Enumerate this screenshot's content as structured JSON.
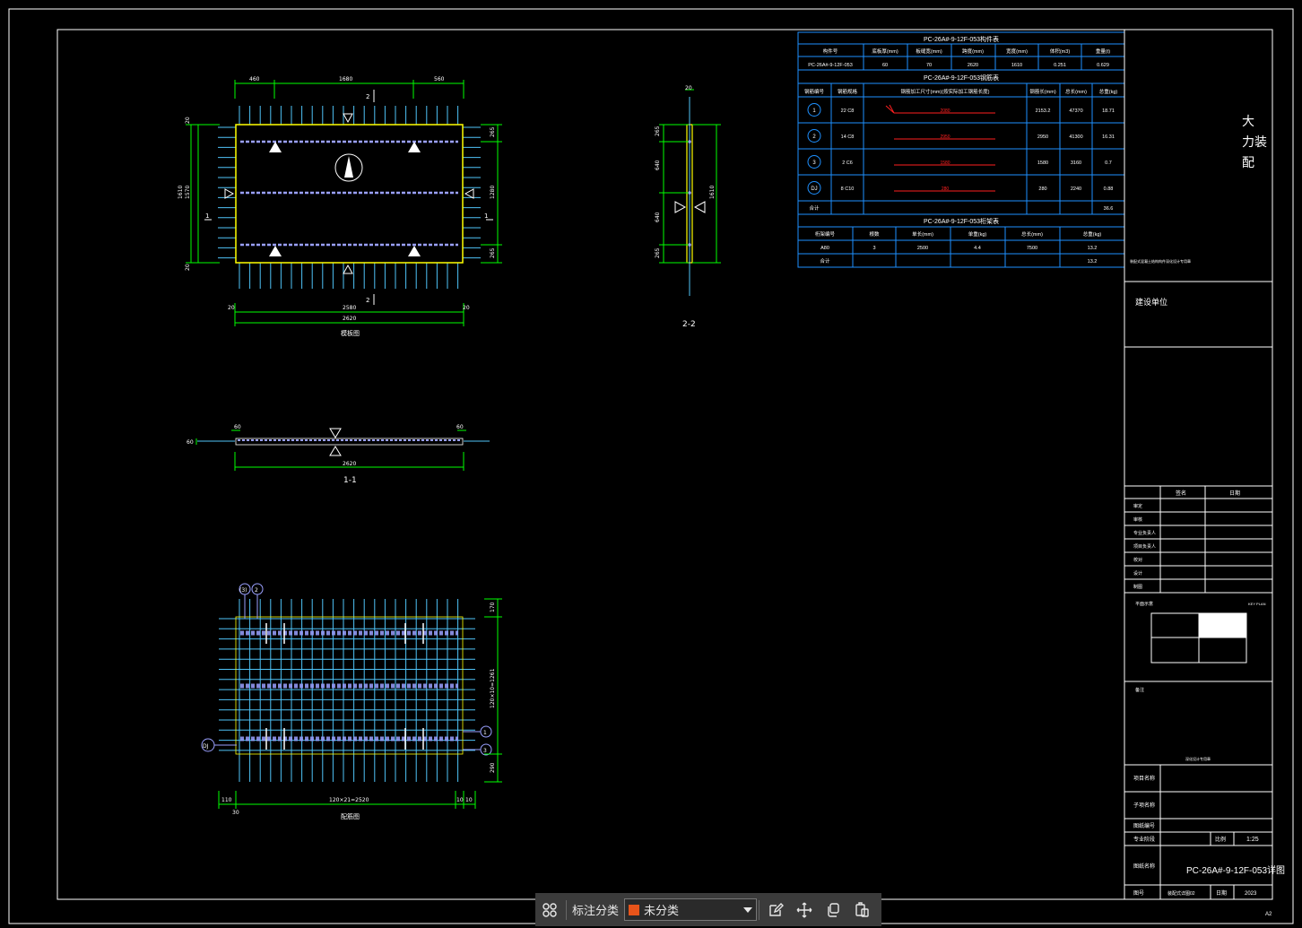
{
  "colors": {
    "background": "#000000",
    "frame": "#ffffff",
    "dimension": "#00ff00",
    "rebar": "#4fc3f7",
    "panel_outline": "#ffff00",
    "mesh": "#9aa0ff",
    "table_line": "#1e90ff",
    "table_text": "#ffffff",
    "red_rebar": "#ff2020",
    "swatch_unclassified": "#e8541a"
  },
  "drawing": {
    "plan": {
      "top_dims": [
        "460",
        "1680",
        "560"
      ],
      "right_dims": [
        "265",
        "1280",
        "265"
      ],
      "left_dims_outer": "1610",
      "left_dims_inner": "1570",
      "left_small": [
        "20",
        "20"
      ],
      "overall_bottom": "2620",
      "inner_bottom": "2580",
      "edge_dims": [
        "20",
        "20"
      ],
      "section_tag_top": "2",
      "section_tag_bottom": "2",
      "section_tag_left": "1",
      "section_tag_right": "1",
      "title": "模板图"
    },
    "section11": {
      "end_dims": [
        "60",
        "60"
      ],
      "thickness": "60",
      "length": "2620",
      "label": "1-1"
    },
    "section22": {
      "top_dim": "20",
      "dims": [
        "265",
        "640",
        "640",
        "265"
      ],
      "overall": "1610",
      "label": "2-2"
    },
    "rebar_plan": {
      "bubbles_top": [
        "(3)",
        "2"
      ],
      "bubbles_right": [
        "1",
        "3"
      ],
      "bubble_left": "DJ",
      "right_dims": [
        "170",
        "120×10=1261",
        "290"
      ],
      "bottom_dims": [
        "110",
        "120×21=2520",
        "10",
        "10"
      ],
      "bottom_small": "30",
      "title": "配筋图"
    }
  },
  "table": {
    "title1": "PC-26A#-9-12F-053构件表",
    "headers1": [
      "构件号",
      "底板厚(mm)",
      "板缝宽(mm)",
      "跨度(mm)",
      "宽度(mm)",
      "体积(m3)",
      "重量(t)"
    ],
    "row1": [
      "PC-26A#-9-12F-053",
      "60",
      "70",
      "2620",
      "1610",
      "0.251",
      "0.629"
    ],
    "title2": "PC-26A#-9-12F-053钢筋表",
    "headers2": [
      "钢筋编号",
      "钢筋规格",
      "钢筋加工尺寸(mm)(按实际加工钢筋长度)",
      "钢筋长(mm)",
      "总长(mm)",
      "总重(kg)"
    ],
    "rows2": [
      {
        "id": "1",
        "spec": "22 C8",
        "len_label": "2080",
        "length": "2153.2",
        "total": "47370",
        "weight": "18.71"
      },
      {
        "id": "2",
        "spec": "14 C8",
        "len_label": "2950",
        "length": "2950",
        "total": "41300",
        "weight": "16.31"
      },
      {
        "id": "3",
        "spec": "2 C6",
        "len_label": "1580",
        "length": "1580",
        "total": "3160",
        "weight": "0.7"
      },
      {
        "id": "DJ",
        "spec": "8 C10",
        "len_label": "280",
        "length": "280",
        "total": "2240",
        "weight": "0.88"
      }
    ],
    "sum_label2": "合计",
    "sum_value2": "36.6",
    "title3": "PC-26A#-9-12F-053桁架表",
    "headers3": [
      "桁架编号",
      "根数",
      "单长(mm)",
      "单重(kg)",
      "总长(mm)",
      "总重(kg)"
    ],
    "row3": [
      "A80",
      "3",
      "2500",
      "4.4",
      "7500",
      "13.2"
    ],
    "sum_label3": "合计",
    "sum_value3": "13.2"
  },
  "titleblock": {
    "company_line1": "大",
    "company_line2": "力装",
    "company_line3": "配",
    "note_small": "装配式混凝土结构构件深化设计专用章",
    "design_unit": "建设单位",
    "sign_headers": [
      "签名",
      "日期"
    ],
    "sign_rows": [
      "审定",
      "审核",
      "专业负责人",
      "项目负责人",
      "校对",
      "设计",
      "制图"
    ],
    "key_plan_label": "平面示意",
    "key_plan_label_right": "KEY PLAN",
    "remark_label": "备注",
    "stamp_note": "深化设计专用章",
    "project_name": "项目名称",
    "subproject": "子项名称",
    "drawing_no": "图纸编号",
    "stage": "专业阶段",
    "scale_label": "比例",
    "scale_value": "1:25",
    "drawing_name_label": "图纸名称",
    "drawing_name": "PC-26A#-9-12F-053详图",
    "sheet_label": "图号",
    "sheet_value": "装配式详图02",
    "date_label": "日期",
    "date_value": "2023",
    "paper": "A2"
  },
  "toolbar": {
    "label": "标注分类",
    "select_value": "未分类",
    "icons": [
      "grid-icon",
      "edit-icon",
      "move-icon",
      "copy-icon",
      "paste-icon"
    ]
  }
}
